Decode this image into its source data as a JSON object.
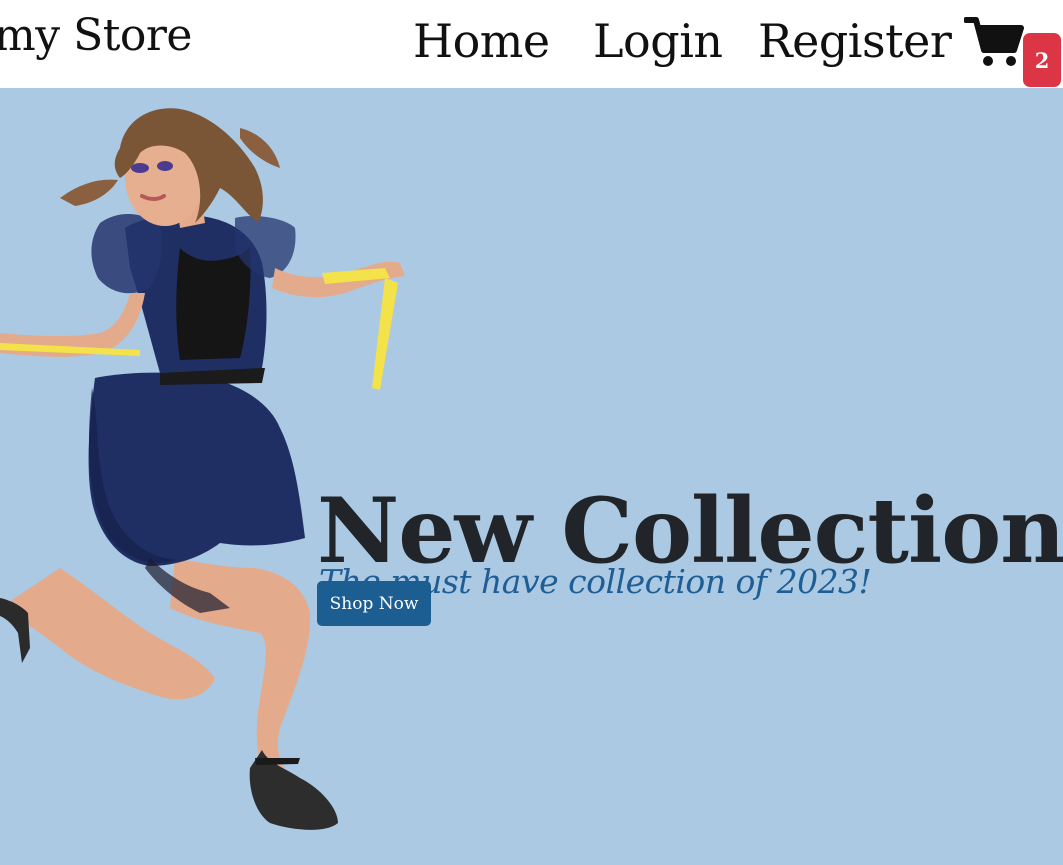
{
  "navbar": {
    "brand": "my Store",
    "links": [
      {
        "label": "Home"
      },
      {
        "label": "Login"
      },
      {
        "label": "Register"
      }
    ],
    "cart": {
      "icon": "shopping-cart-icon",
      "count": "2",
      "badge_color": "#dc3545"
    }
  },
  "hero": {
    "background_color": "#abc9e3",
    "title": "New Collection",
    "subtitle": "The must have collection of 2023!",
    "button_label": "Shop Now",
    "button_color": "#1c5d92",
    "image": "fashion-model-jumping-with-measuring-tape"
  }
}
